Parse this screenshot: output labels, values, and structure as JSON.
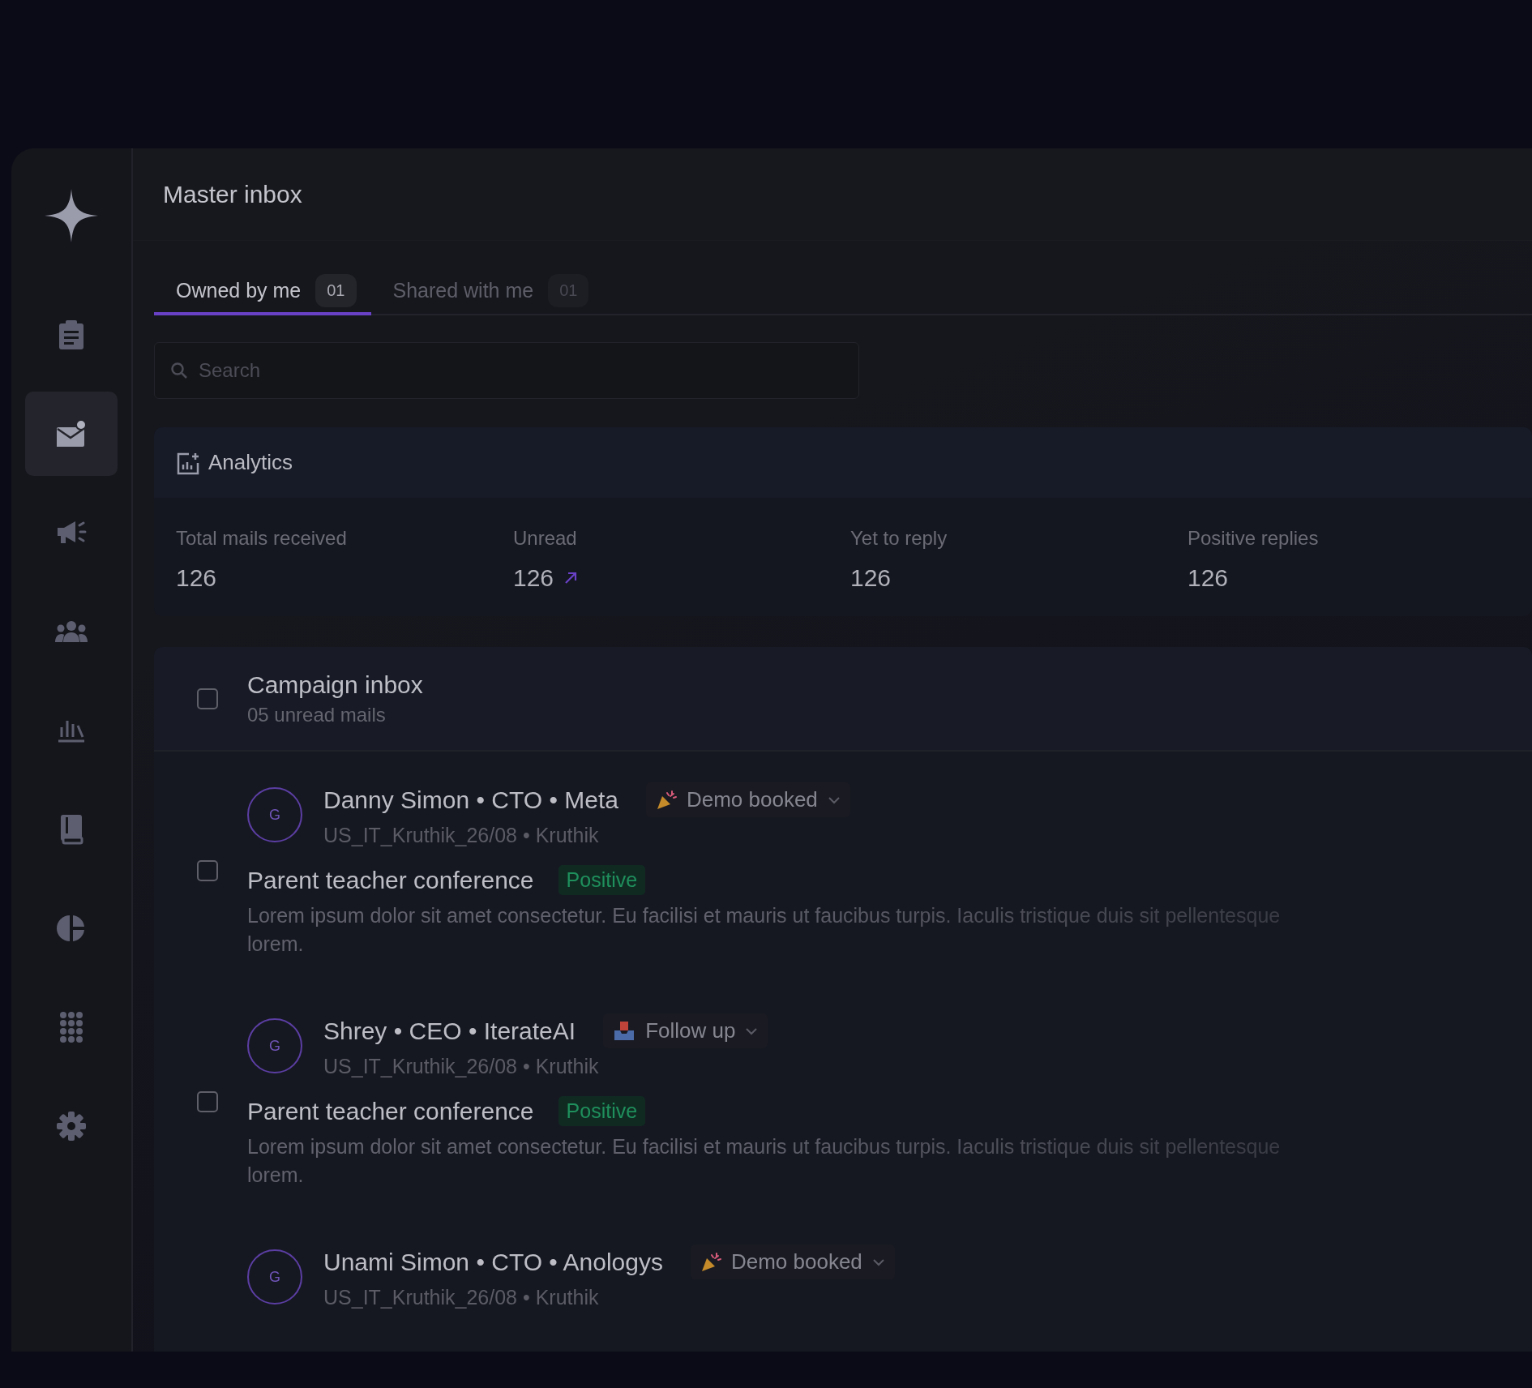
{
  "app": {
    "title": "Master inbox"
  },
  "sidebar": {
    "items": [
      {
        "kind": "clipboard",
        "selected": false
      },
      {
        "kind": "mail",
        "selected": true
      },
      {
        "kind": "megaphone",
        "selected": false
      },
      {
        "kind": "people",
        "selected": false
      },
      {
        "kind": "bars",
        "selected": false
      },
      {
        "kind": "book",
        "selected": false
      },
      {
        "kind": "pie",
        "selected": false
      },
      {
        "kind": "dialpad",
        "selected": false
      },
      {
        "kind": "gear",
        "selected": false
      }
    ]
  },
  "tabs": [
    {
      "label": "Owned by me",
      "count": "01",
      "selected": true
    },
    {
      "label": "Shared with me",
      "count": "01",
      "selected": false
    }
  ],
  "search": {
    "placeholder": "Search"
  },
  "analytics": {
    "title": "Analytics",
    "stats": [
      {
        "label": "Total mails received",
        "value": "126",
        "trend_up": false
      },
      {
        "label": "Unread",
        "value": "126",
        "trend_up": true
      },
      {
        "label": "Yet to reply",
        "value": "126",
        "trend_up": false
      },
      {
        "label": "Positive replies",
        "value": "126",
        "trend_up": false
      }
    ]
  },
  "campaign": {
    "title": "Campaign inbox",
    "subtitle": "05 unread mails",
    "checked": false
  },
  "mails": [
    {
      "avatar": "G",
      "name": "Danny Simon • CTO • Meta",
      "status": {
        "kind": "party",
        "label": "Demo booked"
      },
      "meta": "US_IT_Kruthik_26/08 • Kruthik",
      "checked": false,
      "subject": "Parent teacher conference",
      "tag": "Positive",
      "preview": "Lorem ipsum dolor sit amet consectetur. Eu facilisi et mauris ut faucibus turpis. Iaculis tristique duis sit pellentesque lorem."
    },
    {
      "avatar": "G",
      "name": "Shrey • CEO • IterateAI",
      "status": {
        "kind": "tray",
        "label": "Follow up"
      },
      "meta": "US_IT_Kruthik_26/08 • Kruthik",
      "checked": false,
      "subject": "Parent teacher conference",
      "tag": "Positive",
      "preview": "Lorem ipsum dolor sit amet consectetur. Eu facilisi et mauris ut faucibus turpis. Iaculis tristique duis sit pellentesque lorem."
    },
    {
      "avatar": "G",
      "name": "Unami Simon • CTO • Anologys",
      "status": {
        "kind": "party",
        "label": "Demo booked"
      },
      "meta": "US_IT_Kruthik_26/08 • Kruthik"
    }
  ]
}
